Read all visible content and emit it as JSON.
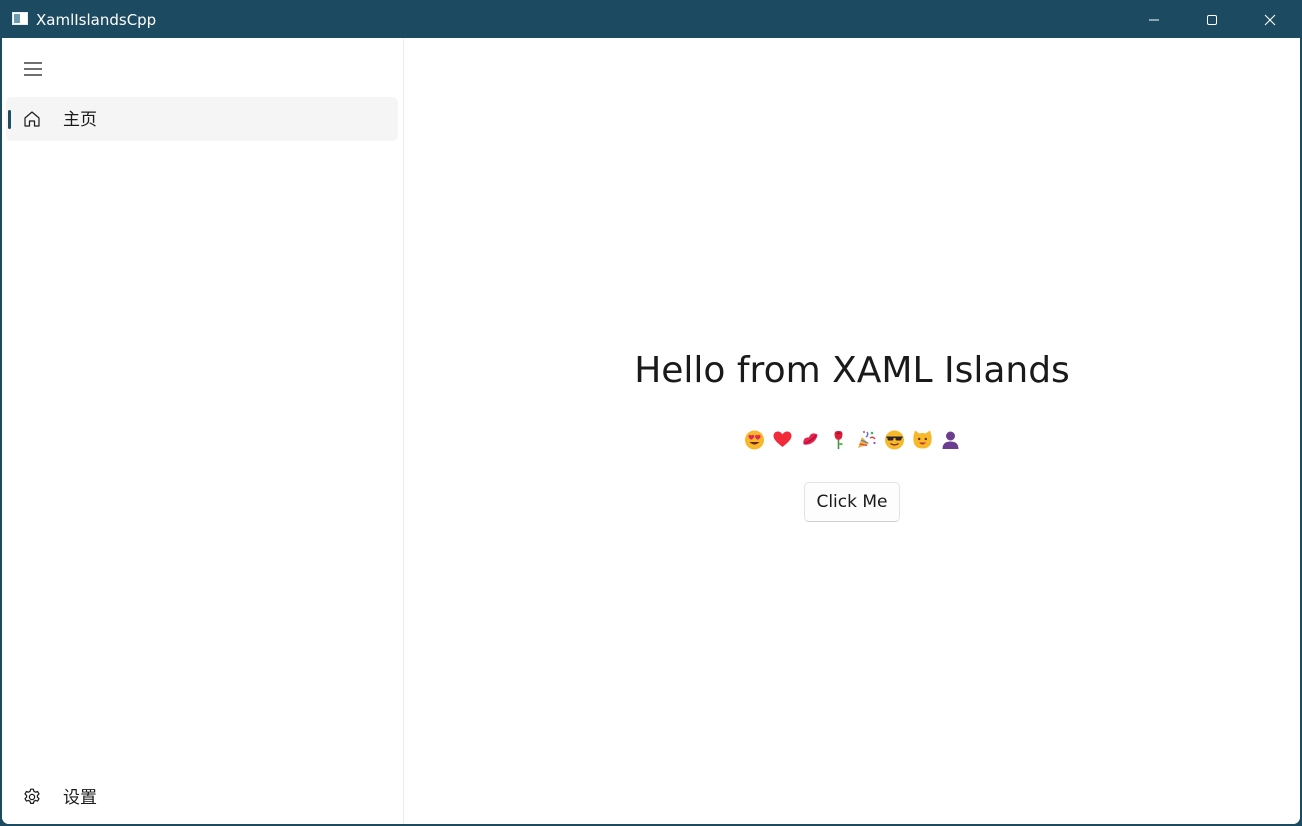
{
  "window": {
    "title": "XamlIslandsCpp",
    "icon": "app-window-icon",
    "controls": [
      "minimize-icon",
      "maximize-icon",
      "close-icon"
    ]
  },
  "nav": {
    "menu_icon": "hamburger-menu-icon",
    "items": [
      {
        "label": "主页",
        "icon": "home-icon",
        "selected": true
      }
    ],
    "footer": {
      "label": "设置",
      "icon": "gear-icon"
    }
  },
  "content": {
    "heading": "Hello from XAML Islands",
    "emojis": [
      "😍",
      "❤️",
      "💋",
      "🌹",
      "🎉",
      "😎",
      "😺",
      "👤"
    ],
    "button_label": "Click Me"
  },
  "colors": {
    "titlebar": "#1c4a60",
    "accent": "#1f4b63",
    "selected_item_bg": "#f5f5f5"
  }
}
